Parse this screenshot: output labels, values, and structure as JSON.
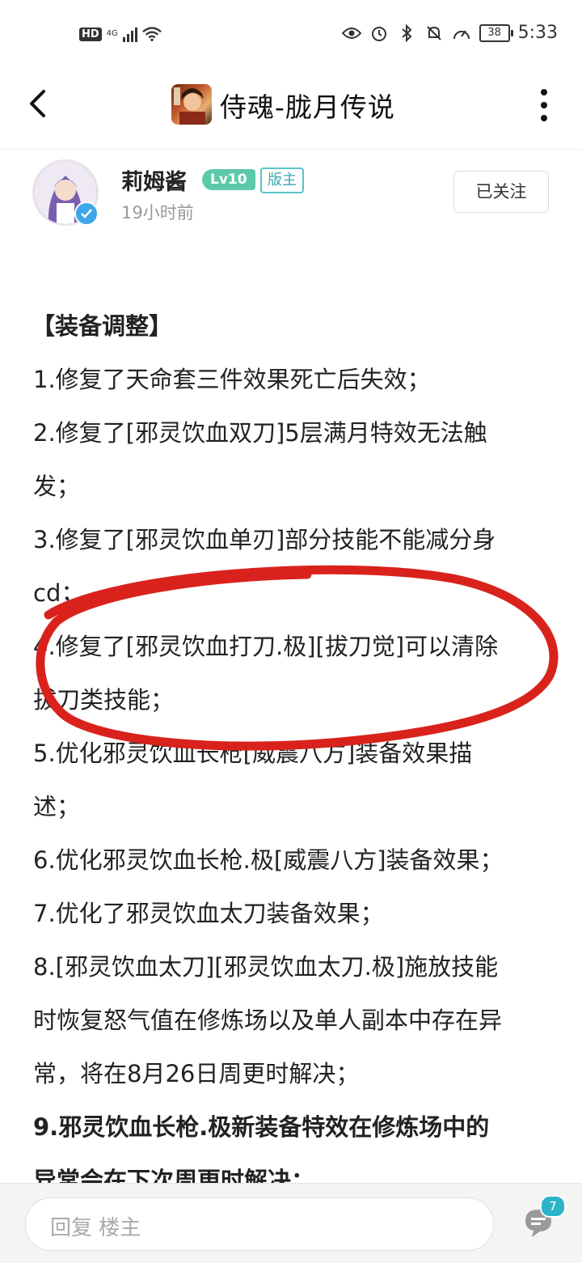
{
  "status_bar": {
    "hd": "HD",
    "network": "4G",
    "battery": "38",
    "time": "5:33"
  },
  "nav": {
    "title": "侍魂-胧月传说",
    "back_icon": "chevron-left-icon",
    "more_icon": "more-vertical-icon"
  },
  "author": {
    "name": "莉姆酱",
    "level": "Lv10",
    "role": "版主",
    "time": "19小时前",
    "follow_label": "已关注"
  },
  "content": {
    "heading": "【装备调整】",
    "lines": [
      "1.修复了天命套三件效果死亡后失效；",
      "2.修复了[邪灵饮血双刀]5层满月特效无法触",
      "发；",
      "3.修复了[邪灵饮血单刃]部分技能不能减分身",
      "cd；",
      "4.修复了[邪灵饮血打刀.极][拔刀觉]可以清除",
      "拔刀类技能；",
      "5.优化邪灵饮血长枪[威震八方]装备效果描",
      "述；",
      "6.优化邪灵饮血长枪.极[威震八方]装备效果；",
      "7.优化了邪灵饮血太刀装备效果；",
      "8.[邪灵饮血太刀][邪灵饮血太刀.极]施放技能",
      "时恢复怒气值在修炼场以及单人副本中存在异",
      "常，将在8月26日周更时解决；"
    ],
    "bold_lines": [
      "9.邪灵饮血长枪.极新装备特效在修炼场中的",
      "异常会在下次周更时解决；"
    ]
  },
  "bottom": {
    "reply_placeholder": "回复  楼主",
    "comment_count": "7"
  },
  "colors": {
    "accent": "#2bb3c8",
    "level_badge": "#5ccaa8",
    "annotation": "#d9221c"
  }
}
